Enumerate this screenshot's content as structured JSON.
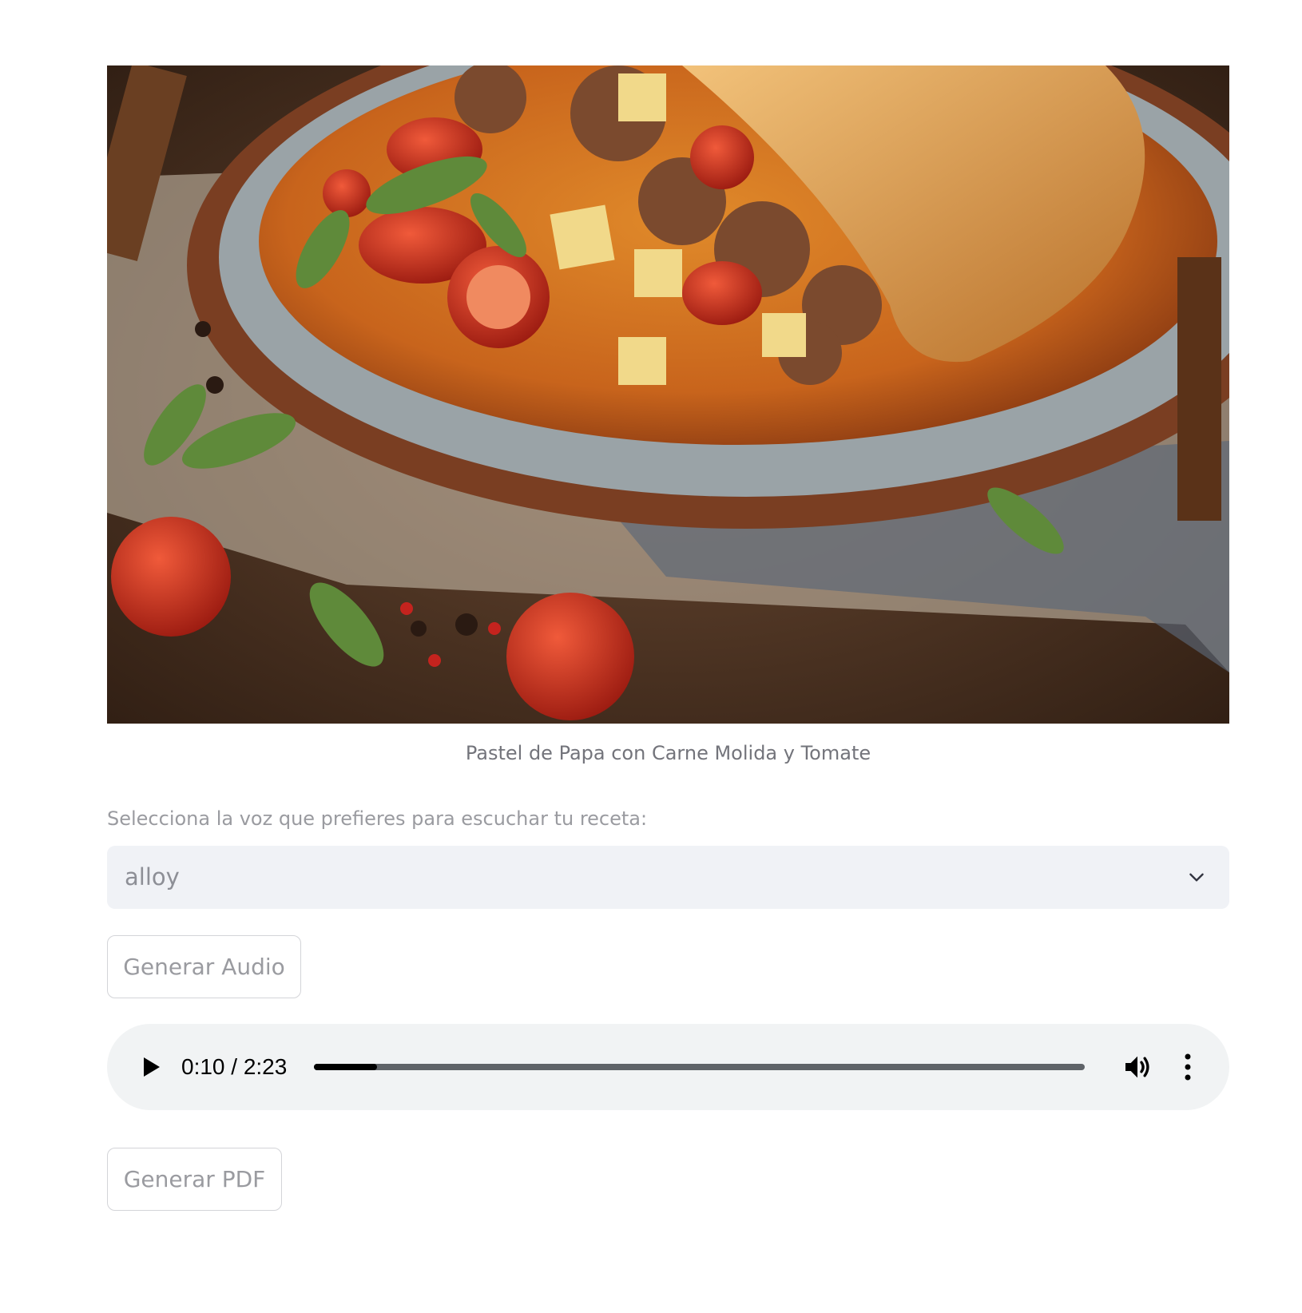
{
  "image": {
    "caption": "Pastel de Papa con Carne Molida y Tomate"
  },
  "voice_select": {
    "label": "Selecciona la voz que prefieres para escuchar tu receta:",
    "value": "alloy"
  },
  "buttons": {
    "generate_audio": "Generar Audio",
    "generate_pdf": "Generar PDF"
  },
  "audio": {
    "time_display": "0:10 / 2:23",
    "progress": 0.082
  },
  "icons": {
    "chevron": "chevron-down-icon",
    "play": "play-icon",
    "volume": "volume-icon",
    "menu": "more-vertical-icon"
  },
  "colors": {
    "select_bg": "#f0f2f6",
    "player_bg": "#f1f3f4",
    "caption": "#73747b",
    "muted_text": "#9a9ba0"
  }
}
